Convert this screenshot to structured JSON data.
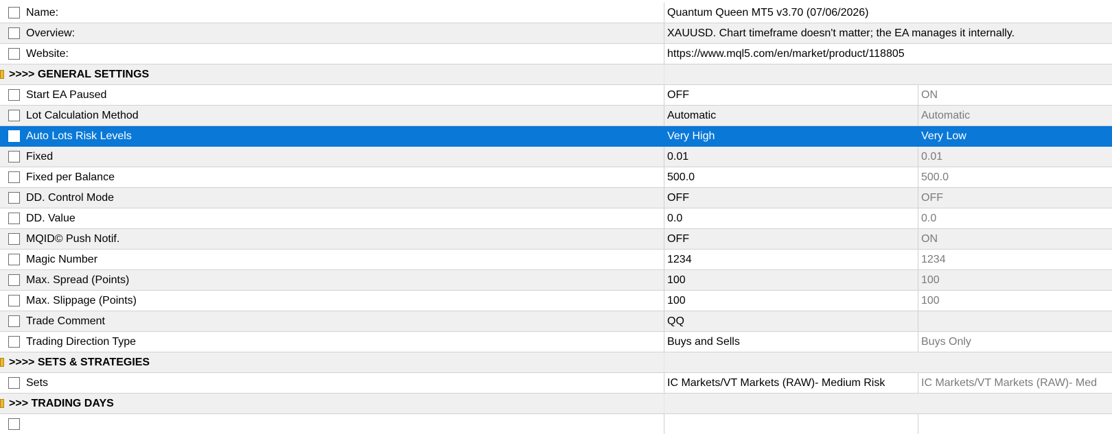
{
  "rows": [
    {
      "type": "row",
      "style": "white",
      "name": "Name:",
      "value": "Quantum Queen MT5 v3.70 (07/06/2026)",
      "default": "",
      "merged": true
    },
    {
      "type": "row",
      "style": "shade",
      "name": "Overview:",
      "value": "XAUUSD. Chart timeframe doesn't matter; the EA manages it internally.",
      "default": "",
      "merged": true
    },
    {
      "type": "row",
      "style": "white",
      "name": "Website:",
      "value": "https://www.mql5.com/en/market/product/118805",
      "default": "",
      "merged": true
    },
    {
      "type": "section",
      "title": ">>>> GENERAL SETTINGS"
    },
    {
      "type": "row",
      "style": "white",
      "name": "Start EA Paused",
      "value": "OFF",
      "default": "ON"
    },
    {
      "type": "row",
      "style": "shade",
      "name": "Lot Calculation Method",
      "value": "Automatic",
      "default": "Automatic"
    },
    {
      "type": "row",
      "style": "selected",
      "name": "Auto Lots Risk Levels",
      "value": "Very High",
      "default": "Very Low"
    },
    {
      "type": "row",
      "style": "shade",
      "name": "Fixed",
      "value": "0.01",
      "default": "0.01"
    },
    {
      "type": "row",
      "style": "white",
      "name": "Fixed per Balance",
      "value": "500.0",
      "default": "500.0"
    },
    {
      "type": "row",
      "style": "shade",
      "name": "DD. Control Mode",
      "value": "OFF",
      "default": "OFF"
    },
    {
      "type": "row",
      "style": "white",
      "name": "DD. Value",
      "value": "0.0",
      "default": "0.0"
    },
    {
      "type": "row",
      "style": "shade",
      "name": "MQID© Push Notif.",
      "value": "OFF",
      "default": "ON"
    },
    {
      "type": "row",
      "style": "white",
      "name": "Magic Number",
      "value": "1234",
      "default": "1234"
    },
    {
      "type": "row",
      "style": "shade",
      "name": "Max. Spread (Points)",
      "value": "100",
      "default": "100"
    },
    {
      "type": "row",
      "style": "white",
      "name": "Max. Slippage (Points)",
      "value": "100",
      "default": "100"
    },
    {
      "type": "row",
      "style": "shade",
      "name": "Trade Comment",
      "value": "QQ",
      "default": ""
    },
    {
      "type": "row",
      "style": "white",
      "name": "Trading Direction Type",
      "value": "Buys and Sells",
      "default": "Buys Only"
    },
    {
      "type": "section",
      "title": ">>>> SETS & STRATEGIES"
    },
    {
      "type": "row",
      "style": "white",
      "name": "Sets",
      "value": "IC Markets/VT Markets (RAW)- Medium Risk",
      "default": "IC Markets/VT Markets (RAW)- Med"
    },
    {
      "type": "section",
      "title": ">>> TRADING DAYS"
    }
  ]
}
